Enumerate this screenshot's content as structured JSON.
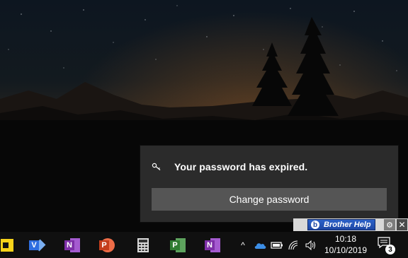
{
  "toast": {
    "message": "Your password has expired.",
    "button_label": "Change password"
  },
  "helpbar": {
    "label": "Brother Help",
    "close_glyph": "✕",
    "gear_glyph": "⚙"
  },
  "taskbar": {
    "apps": [
      {
        "name": "sticky-notes-icon",
        "color": "#f7d31a",
        "glyph": ""
      },
      {
        "name": "visio-icon",
        "color": "#2e6ee0",
        "glyph": "V"
      },
      {
        "name": "onenote-icon",
        "color": "#7e2fa8",
        "glyph": "N"
      },
      {
        "name": "powerpoint-icon",
        "color": "#d24726",
        "glyph": "P"
      },
      {
        "name": "calculator-icon",
        "color": "#e6e6e6",
        "glyph": ""
      },
      {
        "name": "project-icon",
        "color": "#2f7d32",
        "glyph": "P"
      },
      {
        "name": "onenote-2016-icon",
        "color": "#7e2fa8",
        "glyph": "N"
      }
    ],
    "tray": {
      "chevron_glyph": "^",
      "volume_glyph": "🔈"
    },
    "clock": {
      "time": "10:18",
      "date": "10/10/2019"
    },
    "notifications": {
      "count": "3"
    }
  }
}
